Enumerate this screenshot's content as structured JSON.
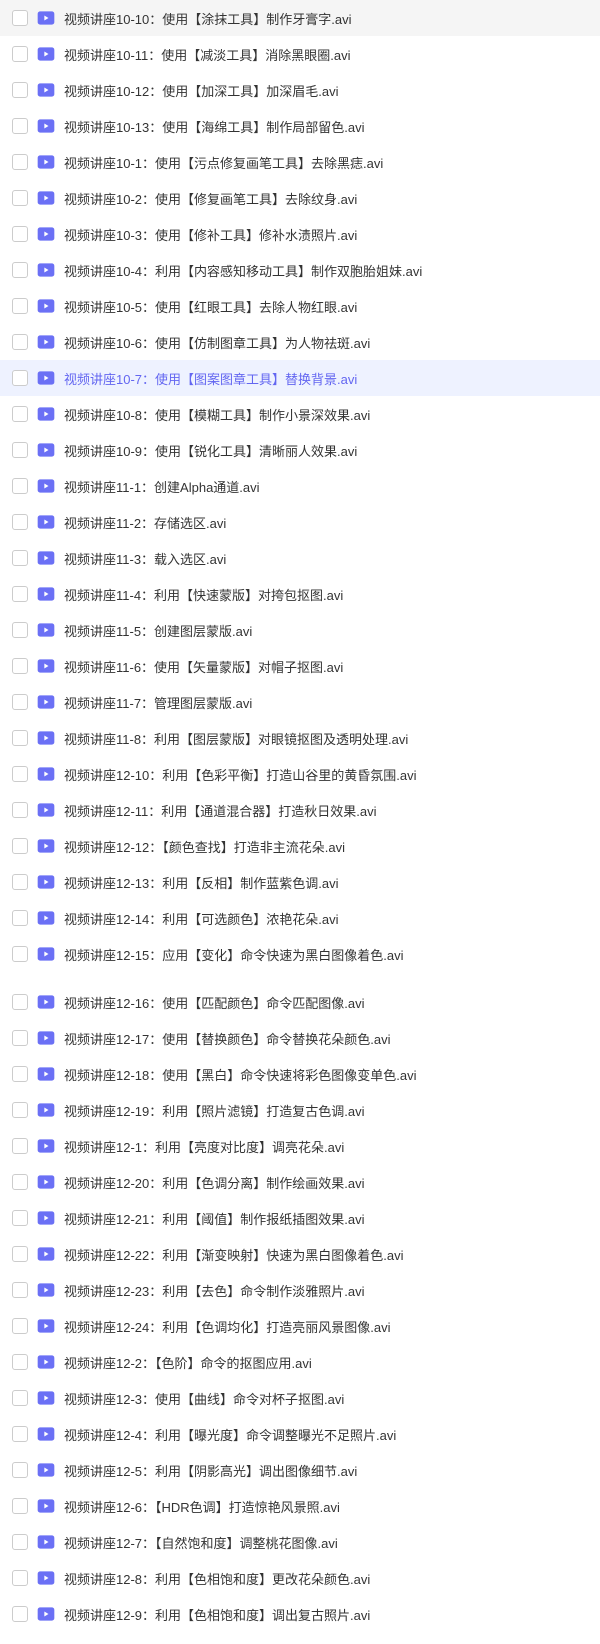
{
  "files": [
    {
      "name": "视频讲座10-10：使用【涂抹工具】制作牙膏字.avi",
      "selected": false
    },
    {
      "name": "视频讲座10-11：使用【减淡工具】消除黑眼圈.avi",
      "selected": false
    },
    {
      "name": "视频讲座10-12：使用【加深工具】加深眉毛.avi",
      "selected": false
    },
    {
      "name": "视频讲座10-13：使用【海绵工具】制作局部留色.avi",
      "selected": false
    },
    {
      "name": "视频讲座10-1：使用【污点修复画笔工具】去除黑痣.avi",
      "selected": false
    },
    {
      "name": "视频讲座10-2：使用【修复画笔工具】去除纹身.avi",
      "selected": false
    },
    {
      "name": "视频讲座10-3：使用【修补工具】修补水渍照片.avi",
      "selected": false
    },
    {
      "name": "视频讲座10-4：利用【内容感知移动工具】制作双胞胎姐妹.avi",
      "selected": false
    },
    {
      "name": "视频讲座10-5：使用【红眼工具】去除人物红眼.avi",
      "selected": false
    },
    {
      "name": "视频讲座10-6：使用【仿制图章工具】为人物祛斑.avi",
      "selected": false
    },
    {
      "name": "视频讲座10-7：使用【图案图章工具】替换背景.avi",
      "selected": true
    },
    {
      "name": "视频讲座10-8：使用【模糊工具】制作小景深效果.avi",
      "selected": false
    },
    {
      "name": "视频讲座10-9：使用【锐化工具】清晰丽人效果.avi",
      "selected": false
    },
    {
      "name": "视频讲座11-1：创建Alpha通道.avi",
      "selected": false
    },
    {
      "name": "视频讲座11-2：存储选区.avi",
      "selected": false
    },
    {
      "name": "视频讲座11-3：载入选区.avi",
      "selected": false
    },
    {
      "name": "视频讲座11-4：利用【快速蒙版】对挎包抠图.avi",
      "selected": false
    },
    {
      "name": "视频讲座11-5：创建图层蒙版.avi",
      "selected": false
    },
    {
      "name": "视频讲座11-6：使用【矢量蒙版】对帽子抠图.avi",
      "selected": false
    },
    {
      "name": "视频讲座11-7：管理图层蒙版.avi",
      "selected": false
    },
    {
      "name": "视频讲座11-8：利用【图层蒙版】对眼镜抠图及透明处理.avi",
      "selected": false
    },
    {
      "name": "视频讲座12-10：利用【色彩平衡】打造山谷里的黄昏氛围.avi",
      "selected": false
    },
    {
      "name": "视频讲座12-11：利用【通道混合器】打造秋日效果.avi",
      "selected": false
    },
    {
      "name": "视频讲座12-12：【颜色查找】打造非主流花朵.avi",
      "selected": false
    },
    {
      "name": "视频讲座12-13：利用【反相】制作蓝紫色调.avi",
      "selected": false
    },
    {
      "name": "视频讲座12-14：利用【可选颜色】浓艳花朵.avi",
      "selected": false
    },
    {
      "name": "视频讲座12-15：应用【变化】命令快速为黑白图像着色.avi",
      "selected": false
    },
    {
      "name": "视频讲座12-16：使用【匹配颜色】命令匹配图像.avi",
      "selected": false,
      "spacer_before": true
    },
    {
      "name": "视频讲座12-17：使用【替换颜色】命令替换花朵颜色.avi",
      "selected": false
    },
    {
      "name": "视频讲座12-18：使用【黑白】命令快速将彩色图像变单色.avi",
      "selected": false
    },
    {
      "name": "视频讲座12-19：利用【照片滤镜】打造复古色调.avi",
      "selected": false
    },
    {
      "name": "视频讲座12-1：利用【亮度对比度】调亮花朵.avi",
      "selected": false
    },
    {
      "name": "视频讲座12-20：利用【色调分离】制作绘画效果.avi",
      "selected": false
    },
    {
      "name": "视频讲座12-21：利用【阈值】制作报纸插图效果.avi",
      "selected": false
    },
    {
      "name": "视频讲座12-22：利用【渐变映射】快速为黑白图像着色.avi",
      "selected": false
    },
    {
      "name": "视频讲座12-23：利用【去色】命令制作淡雅照片.avi",
      "selected": false
    },
    {
      "name": "视频讲座12-24：利用【色调均化】打造亮丽风景图像.avi",
      "selected": false
    },
    {
      "name": "视频讲座12-2：【色阶】命令的抠图应用.avi",
      "selected": false
    },
    {
      "name": "视频讲座12-3：使用【曲线】命令对杯子抠图.avi",
      "selected": false
    },
    {
      "name": "视频讲座12-4：利用【曝光度】命令调整曝光不足照片.avi",
      "selected": false
    },
    {
      "name": "视频讲座12-5：利用【阴影高光】调出图像细节.avi",
      "selected": false
    },
    {
      "name": "视频讲座12-6：【HDR色调】打造惊艳风景照.avi",
      "selected": false
    },
    {
      "name": "视频讲座12-7：【自然饱和度】调整桃花图像.avi",
      "selected": false
    },
    {
      "name": "视频讲座12-8：利用【色相饱和度】更改花朵颜色.avi",
      "selected": false
    },
    {
      "name": "视频讲座12-9：利用【色相饱和度】调出复古照片.avi",
      "selected": false
    }
  ],
  "icon_color": "#6b70f5"
}
